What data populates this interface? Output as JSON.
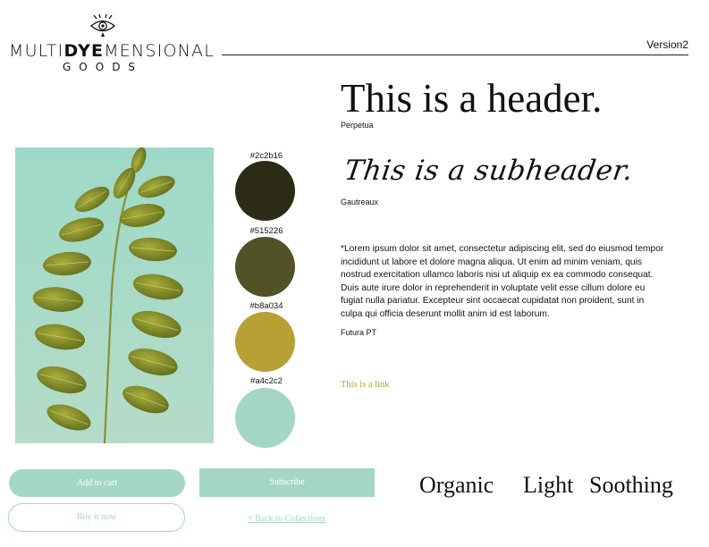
{
  "logo": {
    "line1_a": "MULTI",
    "line1_b": "DYE",
    "line1_c": "MENSIONAL",
    "line2": "GOODS"
  },
  "version": "Version2",
  "header": {
    "text": "This is a header.",
    "font": "Perpetua"
  },
  "subheader": {
    "text": "This is a subheader.",
    "font": "Gautreaux"
  },
  "body": {
    "text": "*Lorem ipsum dolor sit amet, consectetur adipiscing elit, sed do eiusmod tempor incididunt ut labore et dolore magna aliqua. Ut enim ad minim veniam, quis nostrud exercitation ullamco laboris nisi ut aliquip ex ea commodo consequat. Duis aute irure dolor in reprehenderit in voluptate velit esse cillum dolore eu fugiat nulla pariatur. Excepteur sint occaecat cupidatat non proident, sunt in culpa qui officia deserunt mollit anim id est laborum.",
    "font": "Futura PT"
  },
  "link_text": "This is a link",
  "swatches": [
    {
      "label": "#2c2b16",
      "color": "#2c2b16"
    },
    {
      "label": "#515226",
      "color": "#515226"
    },
    {
      "label": "#b8a034",
      "color": "#b8a034"
    },
    {
      "label": "#a4c2c2",
      "color": "#a4d6c6"
    }
  ],
  "buttons": {
    "add_to_cart": "Add to cart",
    "subscribe": "Subscribe",
    "buy_now": "Buy it now",
    "back": "< Back to Collections"
  },
  "words": [
    "Organic",
    "Light",
    "Soothing"
  ]
}
